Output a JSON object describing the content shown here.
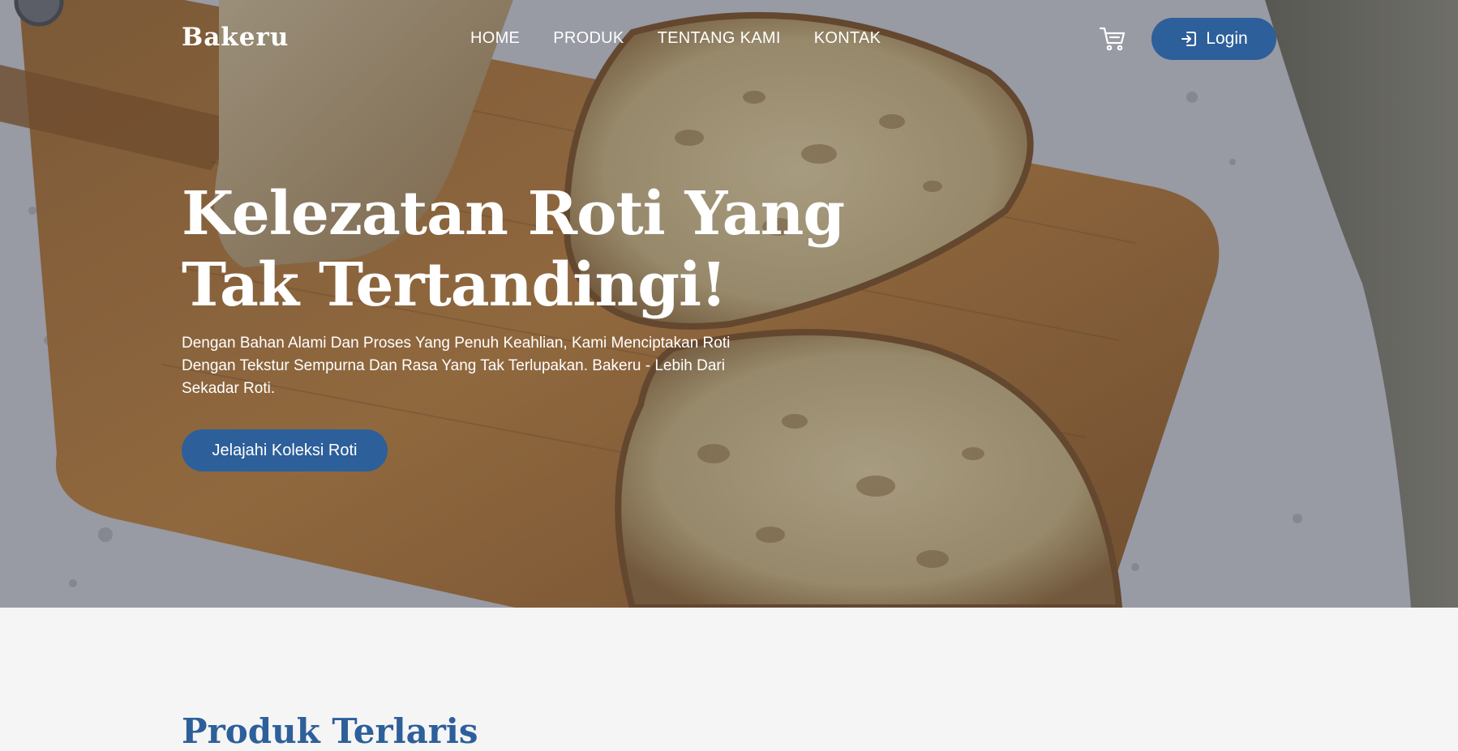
{
  "brand": {
    "logo_text": "Bakeru"
  },
  "nav": {
    "links": [
      {
        "label": "HOME"
      },
      {
        "label": "PRODUK"
      },
      {
        "label": "TENTANG KAMI"
      },
      {
        "label": "KONTAK"
      }
    ],
    "cart_icon": "cart-icon",
    "login": {
      "label": "Login",
      "icon": "login-arrow-icon"
    }
  },
  "hero": {
    "title": "Kelezatan Roti Yang Tak Tertandingi!",
    "description": "Dengan Bahan Alami Dan Proses Yang Penuh Keahlian, Kami Menciptakan Roti Dengan Tekstur Sempurna Dan Rasa Yang Tak Terlupakan. Bakeru - Lebih Dari Sekadar Roti.",
    "cta_label": "Jelajahi Koleksi Roti",
    "background_image": "bread-on-cutting-board-photo"
  },
  "section": {
    "title": "Produk Terlaris"
  },
  "colors": {
    "accent": "#2d5f9a",
    "background": "#f5f5f5",
    "hero_text": "#ffffff"
  }
}
